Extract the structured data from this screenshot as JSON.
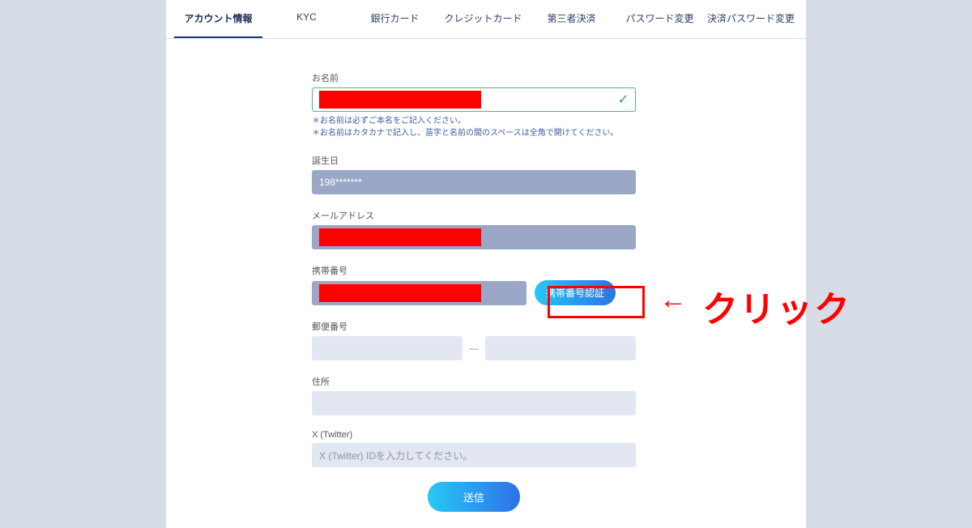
{
  "tabs": [
    {
      "label": "アカウント情報",
      "active": true
    },
    {
      "label": "KYC"
    },
    {
      "label": "銀行カード"
    },
    {
      "label": "クレジットカード"
    },
    {
      "label": "第三者決済"
    },
    {
      "label": "パスワード変更"
    },
    {
      "label": "決済パスワード変更"
    }
  ],
  "fields": {
    "name": {
      "label": "お名前",
      "hints": [
        "＊お名前は必ずご本名をご記入ください。",
        "＊お名前はカタカナで記入し、苗字と名前の間のスペースは全角で開けてください。"
      ]
    },
    "birthday": {
      "label": "誕生日",
      "value": "198*******"
    },
    "email": {
      "label": "メールアドレス"
    },
    "phone": {
      "label": "携帯番号",
      "verify_button": "携帯番号認証"
    },
    "postal": {
      "label": "郵便番号",
      "dash": "—"
    },
    "address": {
      "label": "住所"
    },
    "twitter": {
      "label": "X (Twitter)",
      "placeholder": "X (Twitter) IDを入力してください。"
    }
  },
  "submit_label": "送信",
  "annotation": {
    "arrow": "←",
    "text": "クリック"
  }
}
